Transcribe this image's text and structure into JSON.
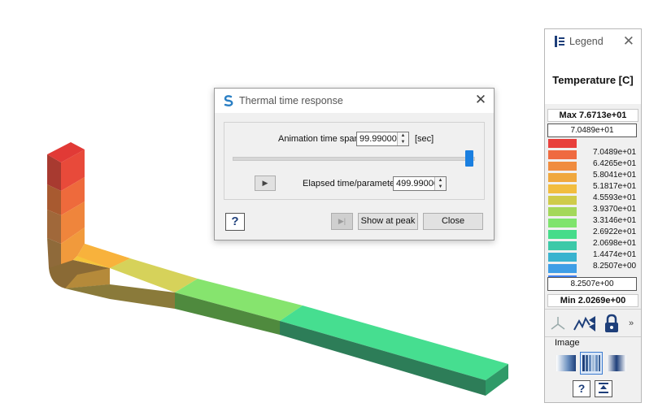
{
  "dialog": {
    "title": "Thermal time response",
    "animation_label": "Animation time span",
    "animation_value": "99.99000",
    "animation_unit": "[sec]",
    "slider_position": 1.0,
    "elapsed_label": "Elapsed time/parameter",
    "elapsed_value": "499.99000",
    "play_glyph": "▶",
    "help_label": "?",
    "step_end_glyph": "▶|",
    "show_peak_label": "Show at peak",
    "close_label": "Close"
  },
  "legend": {
    "title": "Legend",
    "quantity": "Temperature [C]",
    "max_label": "Max  7.6713e+01",
    "top_value": "7.0489e+01",
    "bottom_value": "8.2507e+00",
    "min_label": "Min  2.0269e+00",
    "more_glyph": "»",
    "image_label": "Image",
    "help_label": "?",
    "scale": [
      {
        "color": "#e8403c",
        "label": ""
      },
      {
        "color": "#ef6a40",
        "label": "7.0489e+01"
      },
      {
        "color": "#f08c3f",
        "label": "6.4265e+01"
      },
      {
        "color": "#f0a83e",
        "label": "5.8041e+01"
      },
      {
        "color": "#f2bd3f",
        "label": "5.1817e+01"
      },
      {
        "color": "#cfcb4a",
        "label": "4.5593e+01"
      },
      {
        "color": "#a4d85a",
        "label": "3.9370e+01"
      },
      {
        "color": "#7fe46d",
        "label": "3.3146e+01"
      },
      {
        "color": "#46dc8a",
        "label": "2.6922e+01"
      },
      {
        "color": "#3cc9a8",
        "label": "2.0698e+01"
      },
      {
        "color": "#3ab3cf",
        "label": "1.4474e+01"
      },
      {
        "color": "#3f9ee6",
        "label": "8.2507e+00"
      },
      {
        "color": "#3f7ff0",
        "label": ""
      }
    ],
    "accent": "#1e3f7a"
  }
}
